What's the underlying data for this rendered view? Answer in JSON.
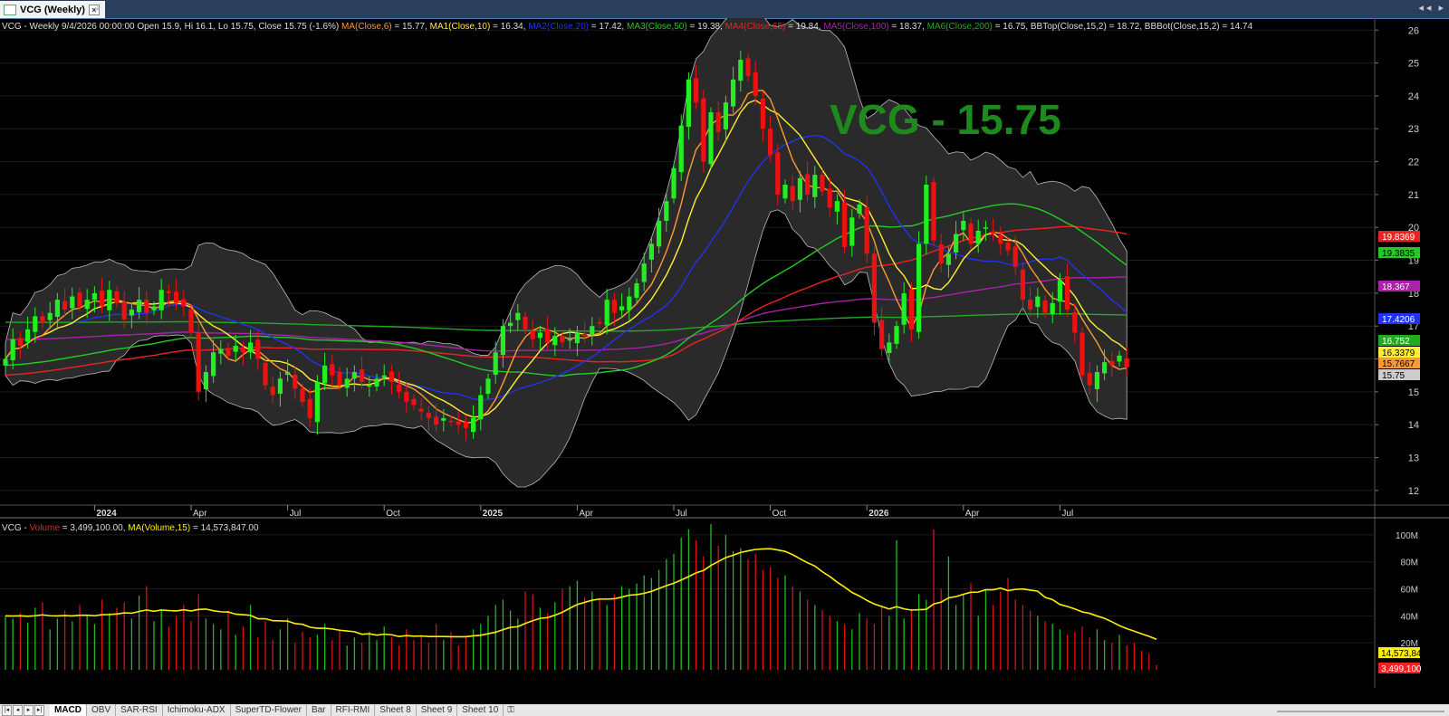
{
  "window": {
    "tab_title": "VCG (Weekly)",
    "close_glyph": "×",
    "pin_glyph": "⌖",
    "nav_prev": "◂ ◂",
    "nav_next": "▸"
  },
  "price_header": {
    "symbol_text": "VCG - Weekly 9/4/2026 00:00:00 Open 15.9, Hi 16.1, Lo 15.75, Close 15.75 (-1.6%)",
    "indicators": [
      {
        "label": "MA(Close,6)",
        "value": " = 15.77,",
        "color": "#ff9933"
      },
      {
        "label": "MA1(Close,10)",
        "value": " = 16.34,",
        "color": "#ffee33"
      },
      {
        "label": "MA2(Close,20)",
        "value": " = 17.42,",
        "color": "#2233ee"
      },
      {
        "label": "MA3(Close,50)",
        "value": " = 19.38,",
        "color": "#22cc22"
      },
      {
        "label": "MA4(Close,65)",
        "value": " = 19.84,",
        "color": "#ee2222"
      },
      {
        "label": "MA5(Close,100)",
        "value": " = 18.37,",
        "color": "#aa22aa"
      },
      {
        "label": "MA6(Close,200)",
        "value": " = 16.75,",
        "color": "#22aa22"
      },
      {
        "label": "BBTop(Close,15,2)",
        "value": " = 18.72,",
        "color": "#dddddd"
      },
      {
        "label": "BBBot(Close,15,2)",
        "value": " = 14.74",
        "color": "#dddddd"
      }
    ]
  },
  "watermark": "VCG - 15.75",
  "volume_header": {
    "prefix": "VCG - ",
    "volume_label": "Volume",
    "volume_value": " = 3,499,100.00, ",
    "ma_label": "MA(Volume,15)",
    "ma_value": " = 14,573,847.00"
  },
  "chart_data": {
    "type": "candlestick",
    "price_axis": {
      "ticks": [
        12,
        13,
        14,
        15,
        16,
        17,
        18,
        19,
        20,
        21,
        22,
        23,
        24,
        25,
        26
      ],
      "range": [
        11.5,
        26.2
      ]
    },
    "volume_axis": {
      "ticks": [
        "20M",
        "40M",
        "60M",
        "80M",
        "100M"
      ],
      "tick_values": [
        20,
        40,
        60,
        80,
        100
      ],
      "range": [
        0,
        112
      ],
      "unit": "M"
    },
    "time_labels": [
      {
        "label": "2024",
        "bold": true,
        "week": 12
      },
      {
        "label": "Apr",
        "bold": false,
        "week": 25
      },
      {
        "label": "Jul",
        "bold": false,
        "week": 38
      },
      {
        "label": "Oct",
        "bold": false,
        "week": 51
      },
      {
        "label": "2025",
        "bold": true,
        "week": 64
      },
      {
        "label": "Apr",
        "bold": false,
        "week": 77
      },
      {
        "label": "Jul",
        "bold": false,
        "week": 90
      },
      {
        "label": "Oct",
        "bold": false,
        "week": 103
      },
      {
        "label": "2026",
        "bold": true,
        "week": 116
      },
      {
        "label": "Apr",
        "bold": false,
        "week": 129
      },
      {
        "label": "Jul",
        "bold": false,
        "week": 142
      }
    ],
    "closes": [
      16.0,
      16.6,
      16.4,
      16.9,
      17.3,
      17.1,
      17.4,
      17.8,
      17.5,
      17.9,
      17.6,
      17.8,
      18.0,
      17.6,
      18.1,
      17.7,
      17.2,
      17.5,
      17.8,
      17.4,
      17.6,
      18.1,
      18.0,
      17.7,
      17.6,
      16.8,
      15.0,
      15.6,
      16.2,
      16.3,
      16.1,
      16.4,
      16.2,
      16.5,
      16.0,
      15.2,
      14.9,
      15.4,
      15.6,
      15.1,
      14.7,
      14.2,
      15.3,
      15.8,
      15.5,
      15.2,
      15.4,
      15.6,
      15.3,
      15.2,
      15.4,
      15.5,
      15.3,
      15.0,
      14.7,
      14.6,
      14.4,
      14.2,
      14.0,
      14.2,
      14.1,
      14.0,
      13.9,
      14.2,
      14.9,
      15.4,
      16.2,
      17.0,
      17.1,
      17.4,
      16.9,
      16.6,
      16.8,
      16.5,
      16.7,
      16.5,
      16.6,
      16.8,
      16.7,
      17.0,
      17.1,
      17.8,
      17.4,
      17.6,
      17.9,
      18.3,
      18.9,
      19.5,
      20.2,
      20.8,
      21.8,
      23.1,
      24.5,
      23.8,
      22.0,
      23.5,
      22.9,
      23.8,
      24.5,
      25.1,
      24.6,
      24.0,
      23.0,
      22.2,
      21.0,
      21.3,
      20.8,
      21.5,
      21.0,
      21.6,
      21.1,
      20.6,
      20.8,
      19.4,
      20.3,
      20.7,
      19.2,
      17.1,
      16.3,
      16.5,
      17.0,
      18.0,
      16.9,
      19.5,
      21.3,
      19.6,
      18.9,
      19.2,
      19.8,
      20.2,
      19.5,
      19.9,
      20.0,
      19.8,
      19.5,
      19.3,
      18.8,
      17.8,
      17.5,
      17.9,
      17.4,
      17.7,
      18.4,
      17.5,
      16.8,
      15.5,
      15.2,
      15.6,
      15.9,
      15.8,
      16.1,
      15.75
    ],
    "volumes_m": [
      40,
      38,
      42,
      35,
      46,
      50,
      30,
      38,
      44,
      36,
      48,
      40,
      34,
      52,
      42,
      46,
      50,
      38,
      55,
      62,
      36,
      44,
      32,
      40,
      48,
      36,
      56,
      38,
      34,
      30,
      44,
      26,
      32,
      48,
      24,
      36,
      22,
      30,
      38,
      20,
      28,
      24,
      26,
      34,
      22,
      30,
      18,
      24,
      20,
      28,
      22,
      32,
      24,
      18,
      30,
      22,
      26,
      20,
      34,
      22,
      28,
      18,
      24,
      30,
      34,
      40,
      48,
      52,
      44,
      38,
      58,
      56,
      46,
      42,
      50,
      60,
      62,
      66,
      54,
      58,
      52,
      48,
      56,
      62,
      60,
      64,
      70,
      68,
      74,
      82,
      86,
      98,
      104,
      96,
      84,
      108,
      92,
      100,
      88,
      90,
      82,
      86,
      74,
      76,
      68,
      70,
      62,
      58,
      52,
      48,
      44,
      40,
      36,
      34,
      30,
      42,
      38,
      34,
      48,
      40,
      96,
      38,
      44,
      56,
      52,
      104,
      60,
      84,
      48,
      56,
      64,
      40,
      60,
      48,
      58,
      68,
      52,
      48,
      44,
      40,
      36,
      34,
      30,
      26,
      28,
      32,
      24,
      30,
      22,
      20,
      26,
      18,
      20,
      14,
      12,
      3.5
    ],
    "series_styles": [
      {
        "key": "ma6",
        "color": "#ff9933"
      },
      {
        "key": "ma10",
        "color": "#ffee33"
      },
      {
        "key": "ma20",
        "color": "#2233ee"
      },
      {
        "key": "ma50",
        "color": "#22cc22"
      },
      {
        "key": "ma65",
        "color": "#ee2222"
      },
      {
        "key": "ma100",
        "color": "#aa22aa"
      },
      {
        "key": "ma200",
        "color": "#22aa22"
      },
      {
        "key": "vol_ma15",
        "color": "#ffee00"
      }
    ],
    "price_badges": [
      {
        "text": "19.8369",
        "value": 19.84,
        "bg": "#ee2222",
        "fg": "#ffffff"
      },
      {
        "text": "19.3835",
        "value": 19.38,
        "bg": "#22cc22",
        "fg": "#000000"
      },
      {
        "text": "18.367",
        "value": 18.37,
        "bg": "#aa22aa",
        "fg": "#ffffff"
      },
      {
        "text": "17.4206",
        "value": 17.42,
        "bg": "#2233ee",
        "fg": "#ffffff"
      },
      {
        "text": "16.752",
        "value": 16.75,
        "bg": "#22aa22",
        "fg": "#ffffff"
      },
      {
        "text": "16.3379",
        "value": 16.34,
        "bg": "#ffee33",
        "fg": "#000000"
      },
      {
        "text": "15.7667",
        "value": 15.77,
        "bg": "#ff9933",
        "fg": "#000000"
      },
      {
        "text": "15.75",
        "value": 15.75,
        "bg": "#cccccc",
        "fg": "#000000"
      }
    ],
    "volume_badges": [
      {
        "text": "14,573,84",
        "value": 14.57,
        "bg": "#ffee00",
        "fg": "#000000"
      },
      {
        "text": "3,499,100",
        "value": 3.5,
        "bg": "#ee2222",
        "fg": "#ffffff"
      }
    ],
    "up_color": "#22ee22",
    "down_color": "#ee1111",
    "bb_fill": "#2a2a2a"
  },
  "sheets": [
    "MACD",
    "OBV",
    "SAR-RSI",
    "Ichimoku-ADX",
    "SuperTD-Flower",
    "Bar",
    "RFI-RMI",
    "Sheet 8",
    "Sheet 9",
    "Sheet 10"
  ],
  "active_sheet": "MACD",
  "sheet_nav": [
    "|◂",
    "◂",
    "▸",
    "▸|"
  ]
}
